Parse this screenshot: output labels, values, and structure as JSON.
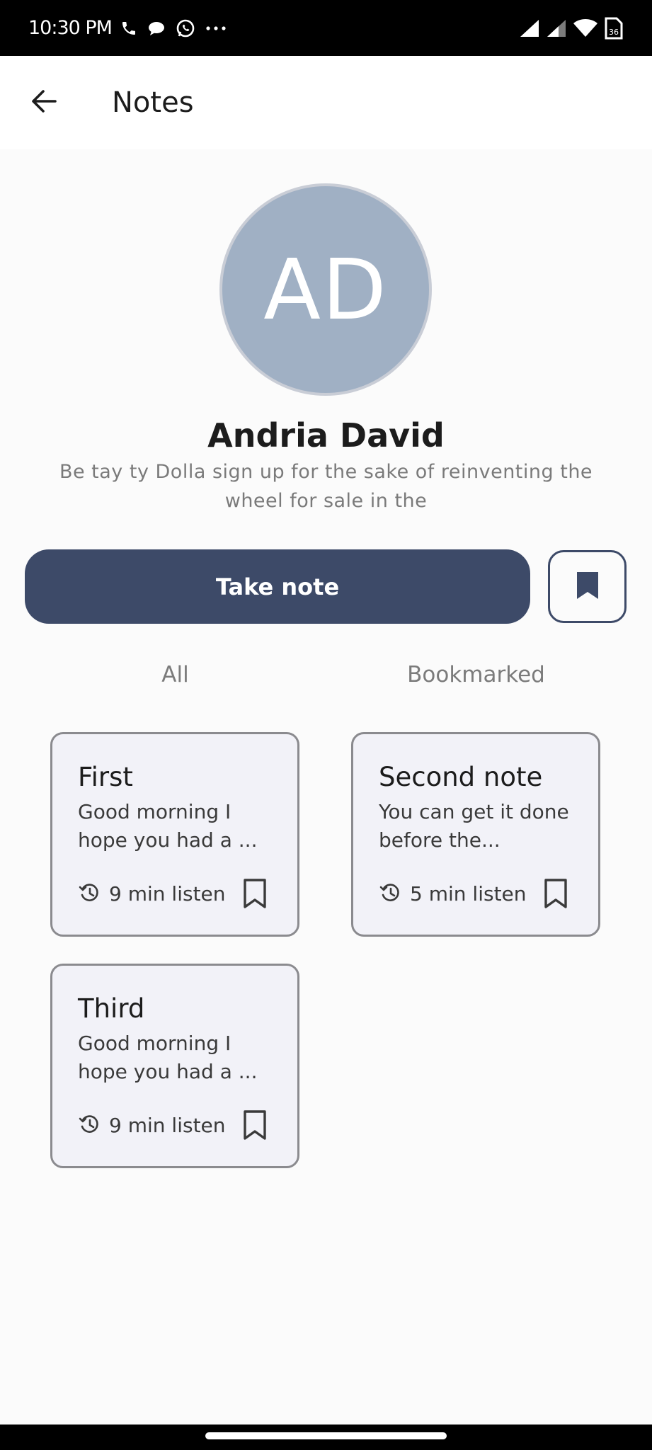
{
  "status_bar": {
    "time": "10:30 PM",
    "left_icons": [
      "phone-icon",
      "message-bubble-icon",
      "whatsapp-icon",
      "more-dots-icon"
    ],
    "right_icons": [
      "cell-signal-icon",
      "cell-signal-2-icon",
      "wifi-icon",
      "sim-icon"
    ],
    "sim_label": "36"
  },
  "app_bar": {
    "title": "Notes",
    "back_icon": "arrow-left-icon"
  },
  "profile": {
    "initials": "AD",
    "avatar_color": "#a0b0c4",
    "name": "Andria David",
    "bio": "Be tay ty Dolla sign up for the sake of reinventing the wheel for sale in the"
  },
  "actions": {
    "take_note_label": "Take note",
    "bookmark_icon": "bookmark-filled-icon",
    "accent_color": "#3d4a68"
  },
  "tabs": [
    {
      "label": "All"
    },
    {
      "label": "Bookmarked"
    }
  ],
  "notes": [
    {
      "title": "First",
      "body": "Good morning I hope you had a ...",
      "duration": "9 min listen"
    },
    {
      "title": "Second note",
      "body": "You can get it done before the...",
      "duration": "5 min listen"
    },
    {
      "title": "Third",
      "body": "Good morning I hope you had a ...",
      "duration": "9 min listen"
    }
  ]
}
